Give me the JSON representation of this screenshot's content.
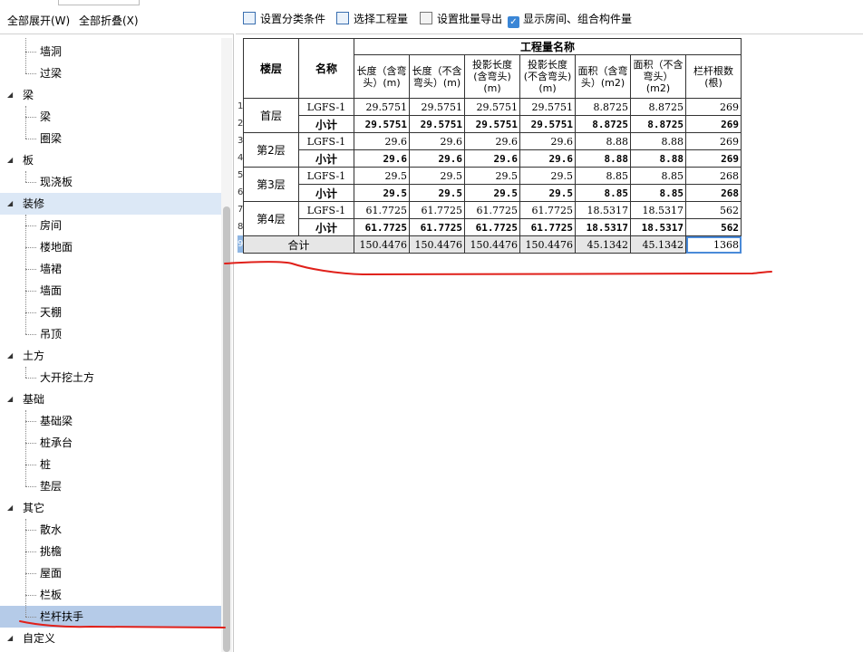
{
  "left_toolbar": {
    "expand_all": "全部展开(W)",
    "collapse_all": "全部折叠(X)"
  },
  "tree": [
    {
      "kind": "child",
      "label": "墙洞"
    },
    {
      "kind": "child",
      "label": "过梁"
    },
    {
      "kind": "parent",
      "label": "梁"
    },
    {
      "kind": "child",
      "label": "梁"
    },
    {
      "kind": "child",
      "label": "圈梁"
    },
    {
      "kind": "parent",
      "label": "板"
    },
    {
      "kind": "child",
      "label": "现浇板"
    },
    {
      "kind": "parent",
      "label": "装修",
      "selected": "light"
    },
    {
      "kind": "child",
      "label": "房间"
    },
    {
      "kind": "child",
      "label": "楼地面"
    },
    {
      "kind": "child",
      "label": "墙裙"
    },
    {
      "kind": "child",
      "label": "墙面"
    },
    {
      "kind": "child",
      "label": "天棚"
    },
    {
      "kind": "child",
      "label": "吊顶"
    },
    {
      "kind": "parent",
      "label": "土方"
    },
    {
      "kind": "child",
      "label": "大开挖土方"
    },
    {
      "kind": "parent",
      "label": "基础"
    },
    {
      "kind": "child",
      "label": "基础梁"
    },
    {
      "kind": "child",
      "label": "桩承台"
    },
    {
      "kind": "child",
      "label": "桩"
    },
    {
      "kind": "child",
      "label": "垫层"
    },
    {
      "kind": "parent",
      "label": "其它"
    },
    {
      "kind": "child",
      "label": "散水"
    },
    {
      "kind": "child",
      "label": "挑檐"
    },
    {
      "kind": "child",
      "label": "屋面"
    },
    {
      "kind": "child",
      "label": "栏板"
    },
    {
      "kind": "child",
      "label": "栏杆扶手",
      "selected": "strong"
    },
    {
      "kind": "parent-leaf",
      "label": "自定义"
    }
  ],
  "right_toolbar": {
    "set_category": "设置分类条件",
    "select_quantity": "选择工程量",
    "set_batch_export": "设置批量导出",
    "show_rooms": "显示房间、组合构件量",
    "show_rooms_checked": true
  },
  "table": {
    "col_floor": "楼层",
    "col_name": "名称",
    "group_header": "工程量名称",
    "quantity_columns": [
      "长度（含弯头）(m)",
      "长度（不含弯头）(m)",
      "投影长度(含弯头)(m)",
      "投影长度(不含弯头)(m)",
      "面积（含弯头）(m2)",
      "面积（不含弯头）(m2)",
      "栏杆根数(根)"
    ],
    "row_numbers": [
      "1",
      "2",
      "3",
      "4",
      "5",
      "6",
      "7",
      "8",
      "9"
    ],
    "floors": [
      {
        "floor": "首层",
        "item": {
          "name": "LGFS-1",
          "values": [
            "29.5751",
            "29.5751",
            "29.5751",
            "29.5751",
            "8.8725",
            "8.8725",
            "269"
          ]
        },
        "subtotal": {
          "name": "小计",
          "values": [
            "29.5751",
            "29.5751",
            "29.5751",
            "29.5751",
            "8.8725",
            "8.8725",
            "269"
          ]
        }
      },
      {
        "floor": "第2层",
        "item": {
          "name": "LGFS-1",
          "values": [
            "29.6",
            "29.6",
            "29.6",
            "29.6",
            "8.88",
            "8.88",
            "269"
          ]
        },
        "subtotal": {
          "name": "小计",
          "values": [
            "29.6",
            "29.6",
            "29.6",
            "29.6",
            "8.88",
            "8.88",
            "269"
          ]
        }
      },
      {
        "floor": "第3层",
        "item": {
          "name": "LGFS-1",
          "values": [
            "29.5",
            "29.5",
            "29.5",
            "29.5",
            "8.85",
            "8.85",
            "268"
          ]
        },
        "subtotal": {
          "name": "小计",
          "values": [
            "29.5",
            "29.5",
            "29.5",
            "29.5",
            "8.85",
            "8.85",
            "268"
          ]
        }
      },
      {
        "floor": "第4层",
        "item": {
          "name": "LGFS-1",
          "values": [
            "61.7725",
            "61.7725",
            "61.7725",
            "61.7725",
            "18.5317",
            "18.5317",
            "562"
          ]
        },
        "subtotal": {
          "name": "小计",
          "values": [
            "61.7725",
            "61.7725",
            "61.7725",
            "61.7725",
            "18.5317",
            "18.5317",
            "562"
          ]
        }
      }
    ],
    "total": {
      "label": "合计",
      "values": [
        "150.4476",
        "150.4476",
        "150.4476",
        "150.4476",
        "45.1342",
        "45.1342",
        "1368"
      ]
    }
  },
  "colors": {
    "annotation_red": "#e0201a",
    "selection_light": "#dce8f6",
    "selection_strong": "#b5cbe8",
    "cell_highlight": "#4a8ad8"
  }
}
